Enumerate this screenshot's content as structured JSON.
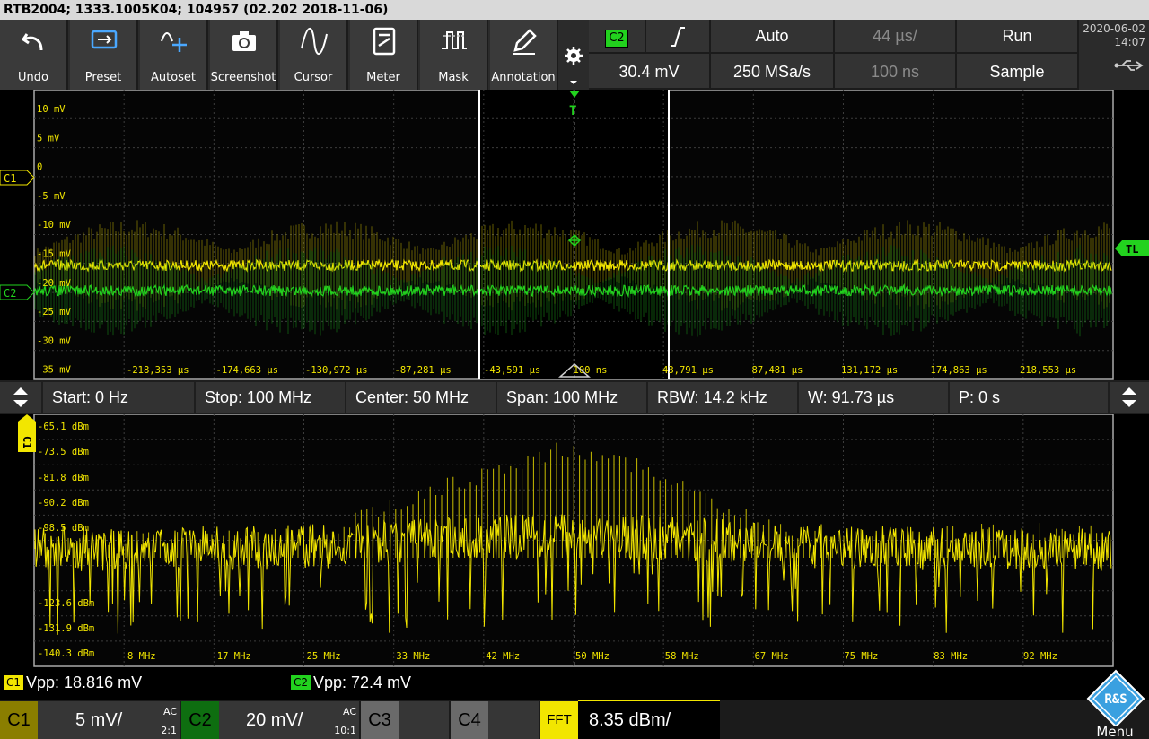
{
  "title": "RTB2004; 1333.1005K04; 104957 (02.202 2018-11-06)",
  "toolbar": [
    {
      "label": "Undo",
      "icon": "undo-icon"
    },
    {
      "label": "Preset",
      "icon": "preset-icon"
    },
    {
      "label": "Autoset",
      "icon": "autoset-icon"
    },
    {
      "label": "Screenshot",
      "icon": "camera-icon"
    },
    {
      "label": "Cursor",
      "icon": "cursor-icon"
    },
    {
      "label": "Meter",
      "icon": "meter-icon"
    },
    {
      "label": "Mask",
      "icon": "mask-icon"
    },
    {
      "label": "Annotation",
      "icon": "pencil-icon"
    }
  ],
  "trigger": {
    "source": "C2",
    "slope": "rising-edge-icon",
    "level": "30.4 mV",
    "mode": "Auto",
    "sample_rate": "250 MSa/s",
    "timebase": "44 µs/",
    "position": "100 ns",
    "run": "Run",
    "acq": "Sample"
  },
  "datetime": {
    "date": "2020-06-02",
    "time": "14:07"
  },
  "scope": {
    "y_labels": [
      "10 mV",
      "5 mV",
      "0",
      "-5 mV",
      "-10 mV",
      "-15 mV",
      "-20 mV",
      "-25 mV",
      "-30 mV",
      "-35 mV"
    ],
    "x_labels": [
      "-218,353 µs",
      "-174,663 µs",
      "-130,972 µs",
      "-87,281 µs",
      "-43,591 µs",
      "100 ns",
      "43,791 µs",
      "87,481 µs",
      "131,172 µs",
      "174,863 µs",
      "218,553 µs"
    ],
    "ch1_marker": "C1",
    "ch2_marker": "C2",
    "tl_marker": "TL",
    "trigger_marker": "T"
  },
  "fftinfo": {
    "start": "Start: 0 Hz",
    "stop": "Stop: 100 MHz",
    "center": "Center: 50 MHz",
    "span": "Span: 100 MHz",
    "rbw": "RBW: 14.2 kHz",
    "window": "W: 91.73 µs",
    "p": "P: 0 s"
  },
  "fft": {
    "marker": "C1",
    "y_labels": [
      "-65.1 dBm",
      "-73.5 dBm",
      "-81.8 dBm",
      "-90.2 dBm",
      "-98.5 dBm",
      "-123.6 dBm",
      "-131.9 dBm",
      "-140.3 dBm"
    ],
    "x_labels": [
      "8 MHz",
      "17 MHz",
      "25 MHz",
      "33 MHz",
      "42 MHz",
      "50 MHz",
      "58 MHz",
      "67 MHz",
      "75 MHz",
      "83 MHz",
      "92 MHz"
    ]
  },
  "measure": {
    "c1_tag": "C1",
    "c1_text": "Vpp: 18.816 mV",
    "c2_tag": "C2",
    "c2_text": "Vpp: 72.4 mV"
  },
  "bottom": {
    "c1_label": "C1",
    "c1_scale": "5 mV/",
    "c1_coupling": "AC",
    "c1_probe": "2:1",
    "c2_label": "C2",
    "c2_scale": "20 mV/",
    "c2_coupling": "AC",
    "c2_probe": "10:1",
    "c3_label": "C3",
    "c4_label": "C4",
    "fft_label": "FFT",
    "fft_scale": "8.35 dBm/",
    "menu": "Menu",
    "logo": "R&S"
  },
  "colors": {
    "ch1": "#f2e600",
    "ch2": "#22d21e",
    "accent": "#3aa0e0"
  }
}
